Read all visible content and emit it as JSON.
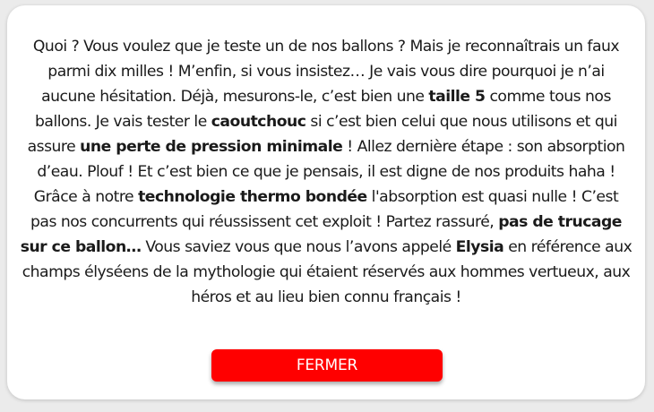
{
  "dialog": {
    "message": [
      {
        "text": "Quoi ? Vous voulez que je teste un de nos ballons ? Mais je reconnaîtrais un faux parmi dix milles ! M’enfin, si vous insistez… Je vais vous dire pourquoi je n’ai aucune hésitation. Déjà, mesurons-le, c’est bien une ",
        "bold": false
      },
      {
        "text": "taille 5",
        "bold": true
      },
      {
        "text": " comme tous nos ballons. Je vais tester le ",
        "bold": false
      },
      {
        "text": "caoutchouc",
        "bold": true
      },
      {
        "text": " si c’est bien celui que nous utilisons et qui assure ",
        "bold": false
      },
      {
        "text": "une perte de pression minimale",
        "bold": true
      },
      {
        "text": " ! Allez dernière étape : son absorption d’eau. Plouf ! Et c’est bien ce que je pensais, il est digne de nos produits haha ! Grâce à notre ",
        "bold": false
      },
      {
        "text": "technologie thermo bondée",
        "bold": true
      },
      {
        "text": " l'absorption est quasi nulle ! C’est pas nos concurrents qui réussissent cet exploit ! Partez rassuré, ",
        "bold": false
      },
      {
        "text": "pas de trucage sur ce ballon…",
        "bold": true
      },
      {
        "text": " Vous saviez vous que nous l’avons appelé ",
        "bold": false
      },
      {
        "text": "Elysia",
        "bold": true
      },
      {
        "text": " en référence aux champs élyséens de la mythologie qui étaient réservés aux hommes vertueux, aux héros et au lieu bien connu français !",
        "bold": false
      }
    ],
    "close_label": "FERMER"
  },
  "colors": {
    "background": "#ebebeb",
    "dialog": "#ffffff",
    "button": "#ff0000",
    "button_text": "#ffffff",
    "text": "#1a1a1a"
  }
}
